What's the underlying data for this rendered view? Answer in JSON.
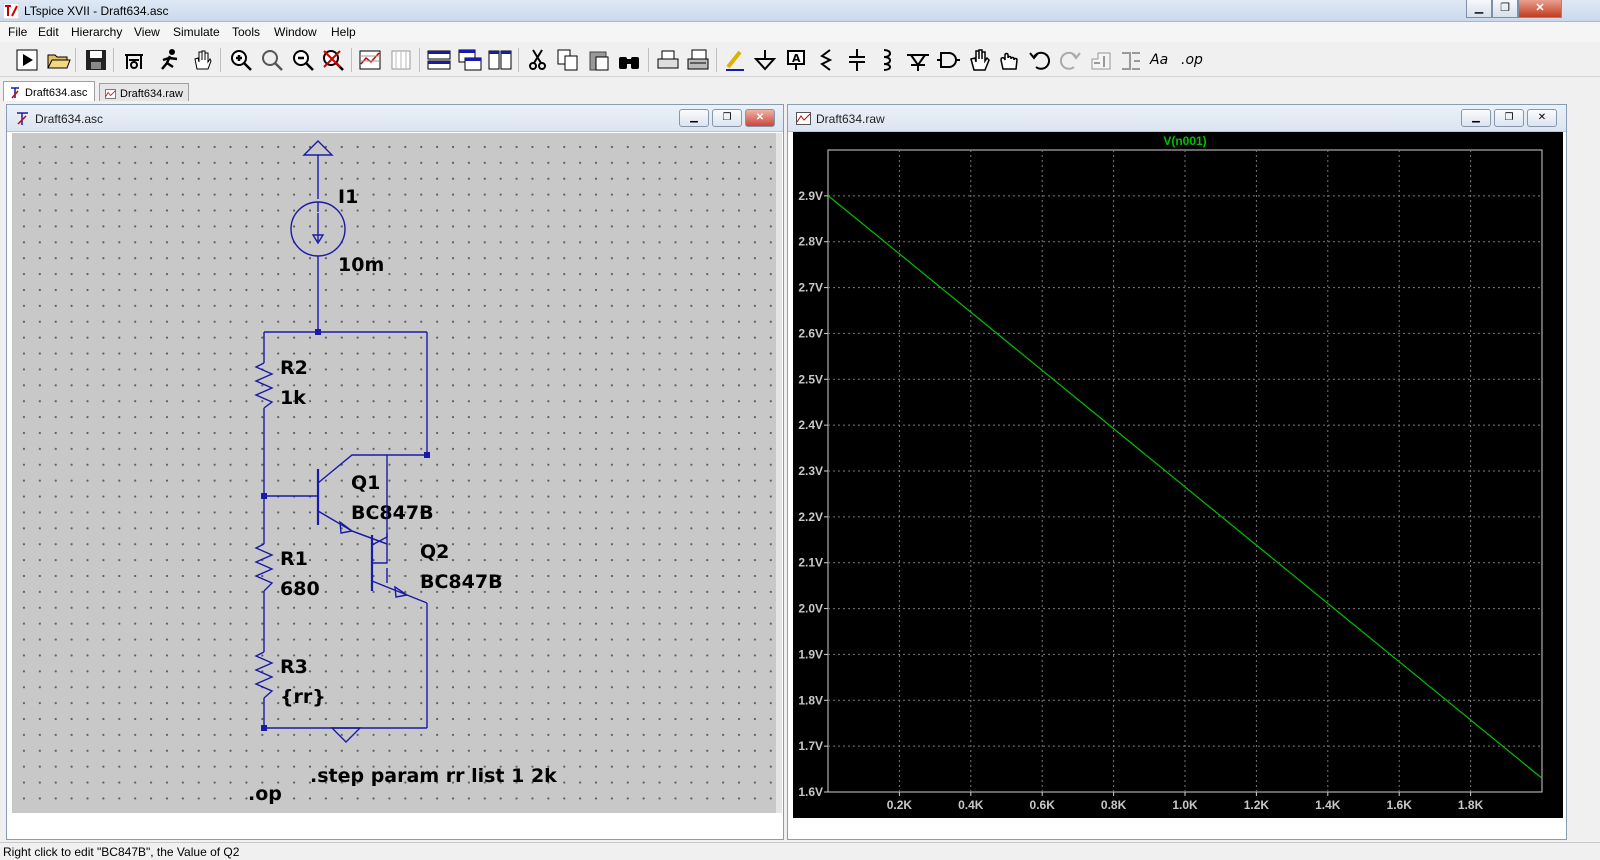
{
  "app": {
    "title": "LTspice XVII - Draft634.asc"
  },
  "menu": [
    "File",
    "Edit",
    "Hierarchy",
    "View",
    "Simulate",
    "Tools",
    "Window",
    "Help"
  ],
  "toolbar": {
    "text_label": "Aa",
    "op_label": ".op",
    "icons": [
      "run-icon",
      "open-icon",
      "save-icon",
      "control-panel-icon",
      "halt-icon",
      "pan-icon",
      "zoom-in-icon",
      "zoom-area-icon",
      "zoom-out-icon",
      "zoom-fit-icon",
      "autorange-icon",
      "plot-settings-icon",
      "tile-horizontal-icon",
      "cascade-icon",
      "tile-vertical-icon",
      "cut-icon",
      "copy-icon",
      "paste-icon",
      "find-icon",
      "print-setup-icon",
      "print-icon",
      "wire-icon",
      "ground-icon",
      "label-net-icon",
      "resistor-icon",
      "capacitor-icon",
      "inductor-icon",
      "diode-icon",
      "component-icon",
      "move-icon",
      "drag-icon",
      "undo-icon",
      "redo-icon",
      "rotate-icon",
      "mirror-icon",
      "text-icon",
      "spice-directive-icon"
    ]
  },
  "tabs": [
    {
      "label": "Draft634.asc",
      "active": true
    },
    {
      "label": "Draft634.raw",
      "active": false
    }
  ],
  "schematic_window": {
    "title": "Draft634.asc",
    "components": {
      "I1": {
        "name": "I1",
        "value": "10m"
      },
      "R2": {
        "name": "R2",
        "value": "1k"
      },
      "Q1": {
        "name": "Q1",
        "value": "BC847B"
      },
      "Q2": {
        "name": "Q2",
        "value": "BC847B"
      },
      "R1": {
        "name": "R1",
        "value": "680"
      },
      "R3": {
        "name": "R3",
        "value": "{rr}"
      }
    },
    "directives": {
      "step": ".step param rr list 1 2k",
      "op": ".op"
    }
  },
  "plot_window": {
    "title": "Draft634.raw",
    "trace_label": "V(n001)"
  },
  "chart_data": {
    "type": "line",
    "title": "",
    "xlabel": "",
    "ylabel": "",
    "xlim": [
      0,
      2000
    ],
    "ylim": [
      1.6,
      3.0
    ],
    "x_ticks": [
      "0.2K",
      "0.4K",
      "0.6K",
      "0.8K",
      "1.0K",
      "1.2K",
      "1.4K",
      "1.6K",
      "1.8K"
    ],
    "x_tick_values": [
      200,
      400,
      600,
      800,
      1000,
      1200,
      1400,
      1600,
      1800
    ],
    "y_ticks": [
      "1.6V",
      "1.7V",
      "1.8V",
      "1.9V",
      "2.0V",
      "2.1V",
      "2.2V",
      "2.3V",
      "2.4V",
      "2.5V",
      "2.6V",
      "2.7V",
      "2.8V",
      "2.9V"
    ],
    "y_tick_values": [
      1.6,
      1.7,
      1.8,
      1.9,
      2.0,
      2.1,
      2.2,
      2.3,
      2.4,
      2.5,
      2.6,
      2.7,
      2.8,
      2.9
    ],
    "grid": true,
    "series": [
      {
        "name": "V(n001)",
        "color": "#00c000",
        "x": [
          1,
          2000
        ],
        "y": [
          2.9,
          1.63
        ]
      }
    ]
  },
  "status": {
    "text": "Right click to edit \"BC847B\", the Value of Q2"
  },
  "colors": {
    "wire": "#1a1aa8",
    "trace": "#00c000",
    "plot_bg": "#000000",
    "grid": "#7a7a7a"
  }
}
